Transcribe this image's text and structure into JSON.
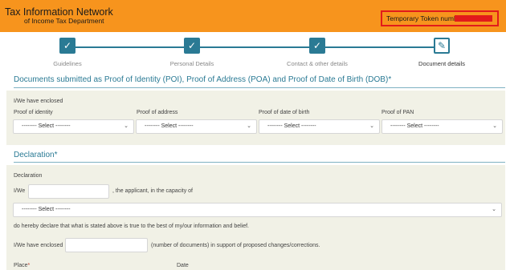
{
  "header": {
    "title": "Tax Information Network",
    "subtitle": "of Income Tax Department",
    "token_label": "Temporary Token number:"
  },
  "steps": [
    {
      "label": "Guidelines",
      "state": "done"
    },
    {
      "label": "Personal Details",
      "state": "done"
    },
    {
      "label": "Contact & other details",
      "state": "done"
    },
    {
      "label": "Document details",
      "state": "active"
    }
  ],
  "icons": {
    "done": "✓",
    "active": "✎"
  },
  "documents": {
    "title": "Documents submitted as Proof of Identity (POI), Proof of Address (POA) and Proof of Date of Birth (DOB)",
    "required_mark": "*",
    "enclosed_label": "I/We have enclosed",
    "fields": [
      {
        "label": "Proof of identity",
        "value": "-------- Select --------"
      },
      {
        "label": "Proof of address",
        "value": "-------- Select --------"
      },
      {
        "label": "Proof of date of birth",
        "value": "-------- Select --------"
      },
      {
        "label": "Proof of PAN",
        "value": "-------- Select --------"
      }
    ]
  },
  "declaration": {
    "title": "Declaration",
    "required_mark": "*",
    "label": "Declaration",
    "iwe": "I/We",
    "capacity_text": ", the applicant, in the capacity of",
    "capacity_select": "-------- Select --------",
    "declare_text": "do hereby declare that what is stated above is true to the best of my/our information and belief.",
    "enclosed_label": "I/We have enclosed",
    "enclosed_suffix": "(number of documents) in support of proposed changes/corrections.",
    "place_label": "Place",
    "place_req": "*",
    "date_label": "Date"
  }
}
